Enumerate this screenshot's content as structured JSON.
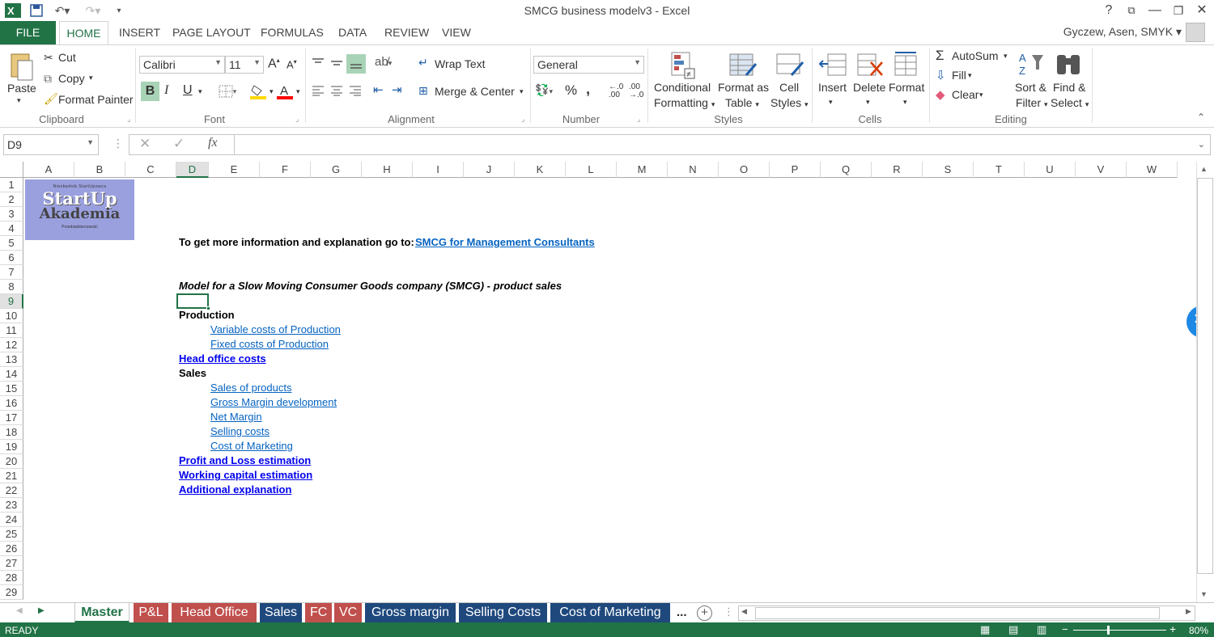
{
  "window": {
    "title": "SMCG business modelv3 - Excel",
    "user": "Gyczew, Asen, SMYK"
  },
  "colors": {
    "excel_green": "#217346",
    "tab_red": "#c0504d",
    "tab_blue": "#1f497d",
    "link": "#0563c1",
    "logo_bg": "#9aa0de"
  },
  "ribbon_tabs": [
    "FILE",
    "HOME",
    "INSERT",
    "PAGE LAYOUT",
    "FORMULAS",
    "DATA",
    "REVIEW",
    "VIEW"
  ],
  "ribbon": {
    "clipboard": {
      "paste": "Paste",
      "cut": "Cut",
      "copy": "Copy",
      "format_painter": "Format Painter",
      "label": "Clipboard"
    },
    "font": {
      "name": "Calibri",
      "size": "11",
      "bold": "B",
      "italic": "I",
      "underline": "U",
      "label": "Font"
    },
    "alignment": {
      "wrap": "Wrap Text",
      "merge": "Merge & Center",
      "label": "Alignment"
    },
    "number": {
      "format": "General",
      "percent": "%",
      "comma": ",",
      "label": "Number"
    },
    "styles": {
      "conditional": "Conditional",
      "conditional2": "Formatting",
      "format_table": "Format as",
      "format_table2": "Table",
      "cell_styles": "Cell",
      "cell_styles2": "Styles",
      "label": "Styles"
    },
    "cells": {
      "insert": "Insert",
      "delete": "Delete",
      "format": "Format",
      "label": "Cells"
    },
    "editing": {
      "autosum": "AutoSum",
      "fill": "Fill",
      "clear": "Clear",
      "sort": "Sort &",
      "sort2": "Filter",
      "find": "Find &",
      "find2": "Select",
      "label": "Editing"
    }
  },
  "formula_bar": {
    "name_box": "D9",
    "fx": "fx",
    "formula": ""
  },
  "columns": [
    "A",
    "B",
    "C",
    "D",
    "E",
    "F",
    "G",
    "H",
    "I",
    "J",
    "K",
    "L",
    "M",
    "N",
    "O",
    "P",
    "Q",
    "R",
    "S",
    "T",
    "U",
    "V",
    "W"
  ],
  "rows": [
    "1",
    "2",
    "3",
    "4",
    "5",
    "6",
    "7",
    "8",
    "9",
    "10",
    "11",
    "12",
    "13",
    "14",
    "15",
    "16",
    "17",
    "18",
    "19",
    "20",
    "21",
    "22",
    "23",
    "24",
    "25",
    "26",
    "27",
    "28",
    "29"
  ],
  "logo": {
    "top": "Niezbędnik StartUpowca",
    "line1": "StartUp",
    "line2": "Akademia",
    "bottom": "Przedsiębiorcowość"
  },
  "cells": {
    "info": "To get more information and explanation go to:",
    "info_link": "SMCG for Management Consultants",
    "model_title": "Model for a Slow Moving Consumer Goods company (SMCG) - product sales",
    "production": "Production",
    "var_costs": "Variable costs of Production",
    "fixed_costs": "Fixed costs of Production",
    "head_office": "Head office costs",
    "sales": "Sales",
    "sales_products": "Sales of products",
    "gross_margin": "Gross Margin development",
    "net_margin": "Net Margin",
    "selling_costs": "Selling costs",
    "cost_marketing": "Cost of Marketing",
    "pnl": "Profit and Loss estimation",
    "working_capital": "Working capital estimation",
    "additional": "Additional explanation"
  },
  "sheet_tabs": [
    "Master",
    "P&L",
    "Head Office",
    "Sales",
    "FC",
    "VC",
    "Gross margin",
    "Selling Costs",
    "Cost of Marketing"
  ],
  "sheet_more": "...",
  "status": {
    "ready": "READY",
    "zoom": "80%"
  }
}
